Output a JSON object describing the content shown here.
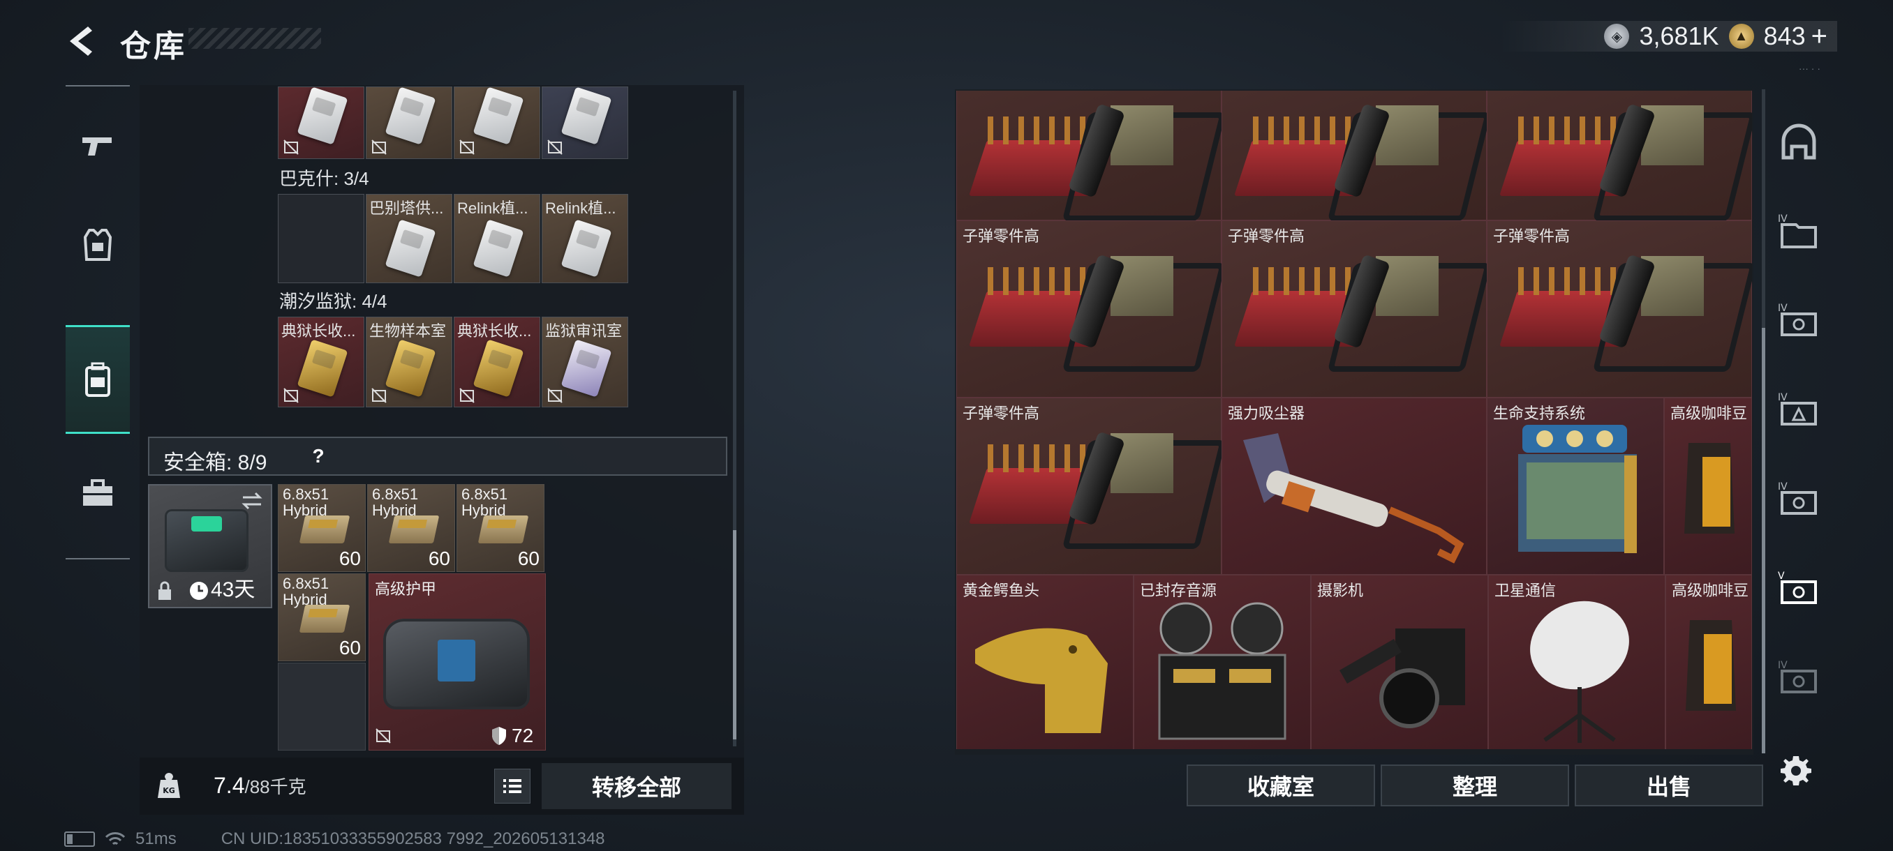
{
  "header": {
    "title": "仓库"
  },
  "currency": [
    {
      "icon": "silver-coin-icon",
      "value": "3,681K"
    },
    {
      "icon": "gold-coin-icon",
      "value": "843",
      "plus": "+"
    }
  ],
  "left_nav": [
    {
      "icon": "gun-icon",
      "active": false
    },
    {
      "icon": "vest-icon",
      "active": false
    },
    {
      "icon": "backpack-icon",
      "active": true
    },
    {
      "icon": "toolbox-icon",
      "active": false
    }
  ],
  "keycards": {
    "row1": [
      {
        "name": ""
      },
      {
        "name": ""
      },
      {
        "name": ""
      },
      {
        "name": ""
      }
    ],
    "group2": {
      "label": "巴克什: 3/4",
      "items": [
        {
          "name": ""
        },
        {
          "name": "巴别塔供..."
        },
        {
          "name": "Relink植..."
        },
        {
          "name": "Relink植..."
        }
      ]
    },
    "group3": {
      "label": "潮汐监狱: 4/4",
      "items": [
        {
          "name": "典狱长收..."
        },
        {
          "name": "生物样本室"
        },
        {
          "name": "典狱长收..."
        },
        {
          "name": "监狱审讯室"
        }
      ]
    }
  },
  "safebox": {
    "label": "安全箱: 8/9",
    "help": "?",
    "days": "43天",
    "ammo": [
      {
        "name": "6.8x51\nHybrid",
        "count": "60"
      },
      {
        "name": "6.8x51\nHybrid",
        "count": "60"
      },
      {
        "name": "6.8x51\nHybrid",
        "count": "60"
      },
      {
        "name": "6.8x51\nHybrid",
        "count": "60"
      }
    ],
    "armor": {
      "name": "高级护甲",
      "durability": "72"
    }
  },
  "bottom_left": {
    "weight": "7.4",
    "weight_max": "/88千克",
    "transfer_all": "转移全部"
  },
  "stash": {
    "items": [
      {
        "name": ""
      },
      {
        "name": ""
      },
      {
        "name": ""
      },
      {
        "name": "子弹零件高"
      },
      {
        "name": "子弹零件高"
      },
      {
        "name": "子弹零件高"
      },
      {
        "name": "子弹零件高"
      },
      {
        "name": "强力吸尘器"
      },
      {
        "name": "生命支持系统"
      },
      {
        "name": "高级咖啡豆"
      },
      {
        "name": "黄金鳄鱼头"
      },
      {
        "name": "已封存音源"
      },
      {
        "name": "摄影机"
      },
      {
        "name": "卫星通信"
      },
      {
        "name": "高级咖啡豆"
      }
    ],
    "tabs": [
      "收藏室",
      "整理",
      "出售"
    ]
  },
  "right_nav": [
    {
      "icon": "helmet-icon"
    },
    {
      "icon": "folder-iv-icon"
    },
    {
      "icon": "ticket-iv-icon"
    },
    {
      "icon": "triangle-iv-icon"
    },
    {
      "icon": "ticket-iv-icon"
    },
    {
      "icon": "ticket-v-icon"
    },
    {
      "icon": "ticket-iv-icon"
    }
  ],
  "status": {
    "ping": "51ms",
    "uid": "CN UID:18351033355902583 7992_202605131348"
  },
  "colors": {
    "accent": "#3fe0c8",
    "item_red": "#55282d",
    "panel": "#1a1e23"
  }
}
